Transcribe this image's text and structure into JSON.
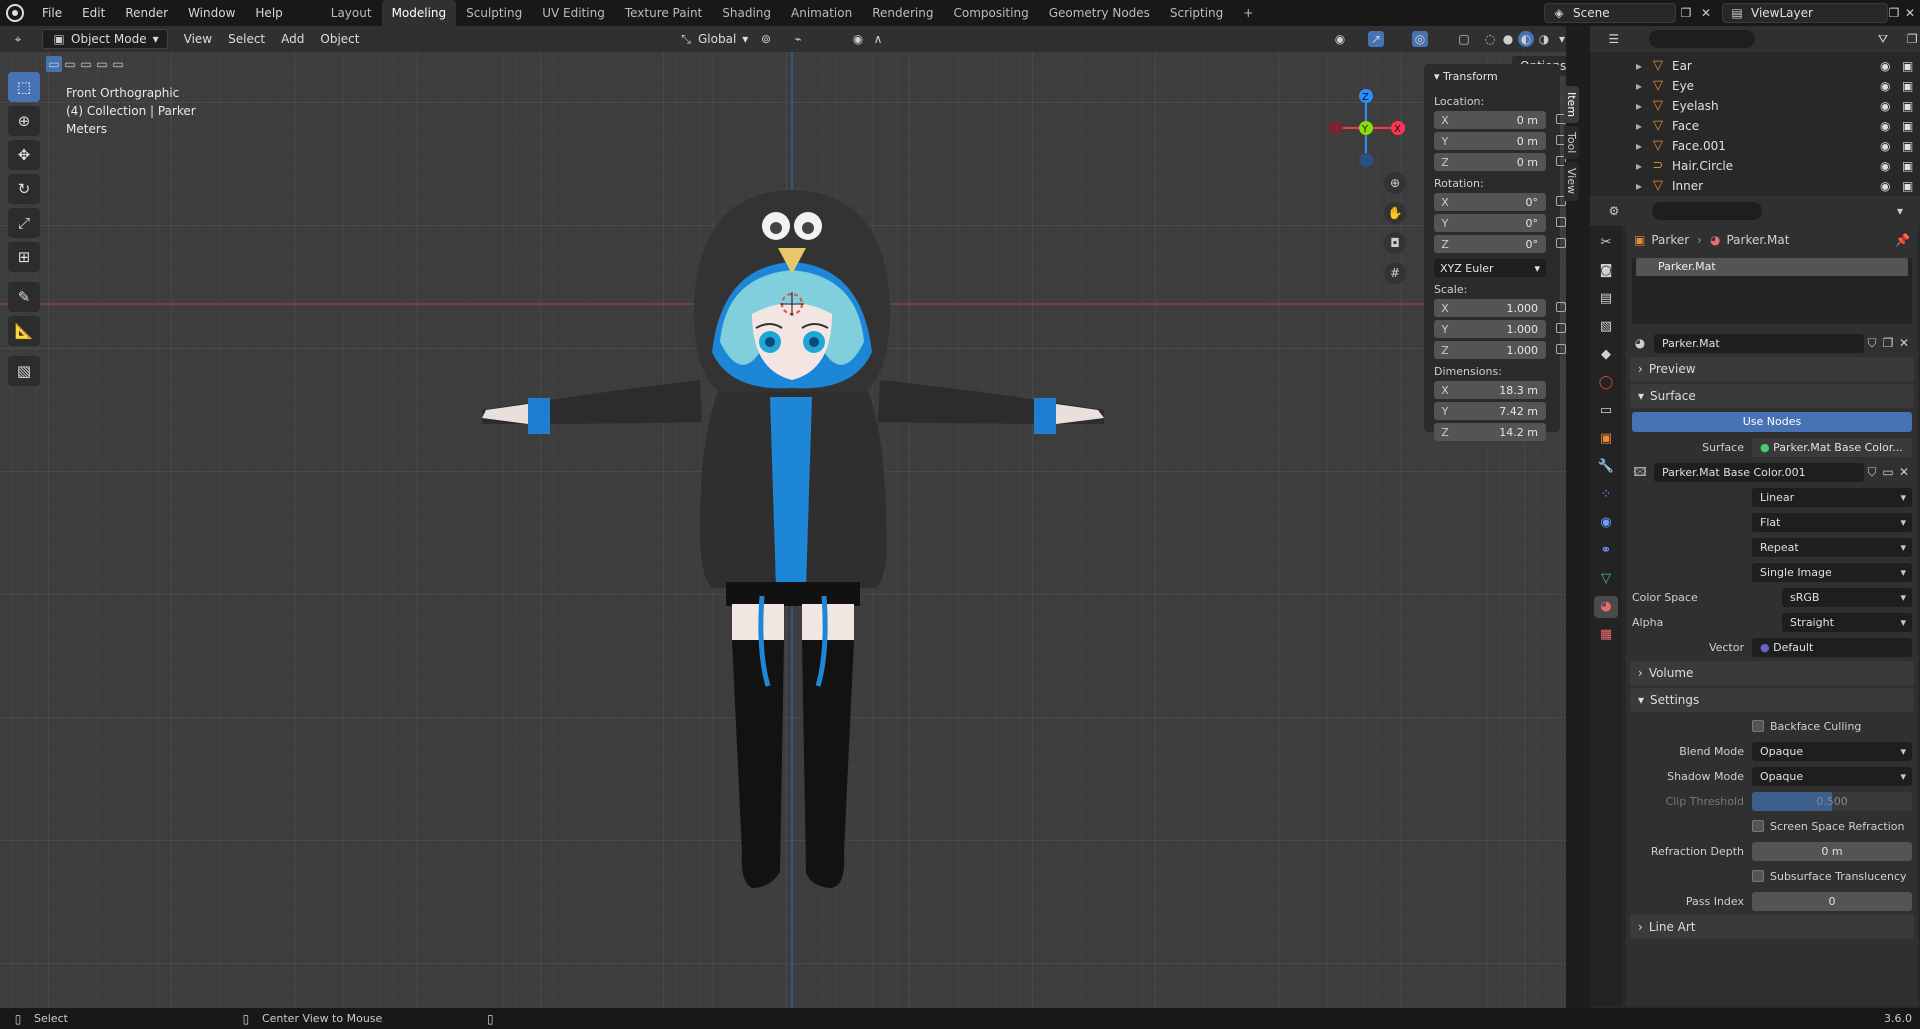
{
  "menu": {
    "file": "File",
    "edit": "Edit",
    "render": "Render",
    "window": "Window",
    "help": "Help"
  },
  "workspaces": [
    "Layout",
    "Modeling",
    "Sculpting",
    "UV Editing",
    "Texture Paint",
    "Shading",
    "Animation",
    "Rendering",
    "Compositing",
    "Geometry Nodes",
    "Scripting"
  ],
  "active_workspace": "Modeling",
  "scene": {
    "label": "Scene"
  },
  "view_layer": {
    "label": "ViewLayer"
  },
  "vheader": {
    "mode": "Object Mode",
    "view": "View",
    "select": "Select",
    "add": "Add",
    "object": "Object",
    "orientation": "Global",
    "options": "Options"
  },
  "overlay": {
    "view_name": "Front Orthographic",
    "collection": "(4) Collection | Parker",
    "units": "Meters"
  },
  "npanel": {
    "title": "Transform",
    "location_label": "Location:",
    "location": [
      {
        "ax": "X",
        "val": "0 m"
      },
      {
        "ax": "Y",
        "val": "0 m"
      },
      {
        "ax": "Z",
        "val": "0 m"
      }
    ],
    "rotation_label": "Rotation:",
    "rotation": [
      {
        "ax": "X",
        "val": "0°"
      },
      {
        "ax": "Y",
        "val": "0°"
      },
      {
        "ax": "Z",
        "val": "0°"
      }
    ],
    "rotation_mode": "XYZ Euler",
    "scale_label": "Scale:",
    "scale": [
      {
        "ax": "X",
        "val": "1.000"
      },
      {
        "ax": "Y",
        "val": "1.000"
      },
      {
        "ax": "Z",
        "val": "1.000"
      }
    ],
    "dimensions_label": "Dimensions:",
    "dimensions": [
      {
        "ax": "X",
        "val": "18.3 m"
      },
      {
        "ax": "Y",
        "val": "7.42 m"
      },
      {
        "ax": "Z",
        "val": "14.2 m"
      }
    ],
    "tabs": [
      "Item",
      "Tool",
      "View"
    ]
  },
  "gizmo": {
    "z": "Z",
    "y": "Y",
    "x": "X"
  },
  "outliner": {
    "items": [
      "Ear",
      "Eye",
      "Eyelash",
      "Face",
      "Face.001",
      "Hair.Circle",
      "Inner"
    ]
  },
  "props": {
    "breadcrumb_object": "Parker",
    "breadcrumb_material": "Parker.Mat",
    "slot_name": "Parker.Mat",
    "material_name": "Parker.Mat",
    "sections": {
      "preview": "Preview",
      "surface": "Surface",
      "volume": "Volume",
      "settings": "Settings",
      "line_art": "Line Art"
    },
    "use_nodes": "Use Nodes",
    "surface_label": "Surface",
    "surface_value": "Parker.Mat Base Color...",
    "image_name": "Parker.Mat Base Color.001",
    "interp": "Linear",
    "projection": "Flat",
    "extension": "Repeat",
    "source": "Single Image",
    "color_space_label": "Color Space",
    "color_space": "sRGB",
    "alpha_label": "Alpha",
    "alpha": "Straight",
    "vector_label": "Vector",
    "vector": "Default",
    "backface": "Backface Culling",
    "blend_label": "Blend Mode",
    "blend": "Opaque",
    "shadow_label": "Shadow Mode",
    "shadow": "Opaque",
    "clip_label": "Clip Threshold",
    "clip": "0.500",
    "ssr": "Screen Space Refraction",
    "refr_label": "Refraction Depth",
    "refr": "0 m",
    "sss": "Subsurface Translucency",
    "pass_label": "Pass Index",
    "pass": "0"
  },
  "status": {
    "select": "Select",
    "center": "Center View to Mouse",
    "version": "3.6.0"
  },
  "colors": {
    "accent": "#4772b3",
    "axis_x": "#ff3352",
    "axis_y": "#8bdc00",
    "axis_z": "#2890ff"
  }
}
